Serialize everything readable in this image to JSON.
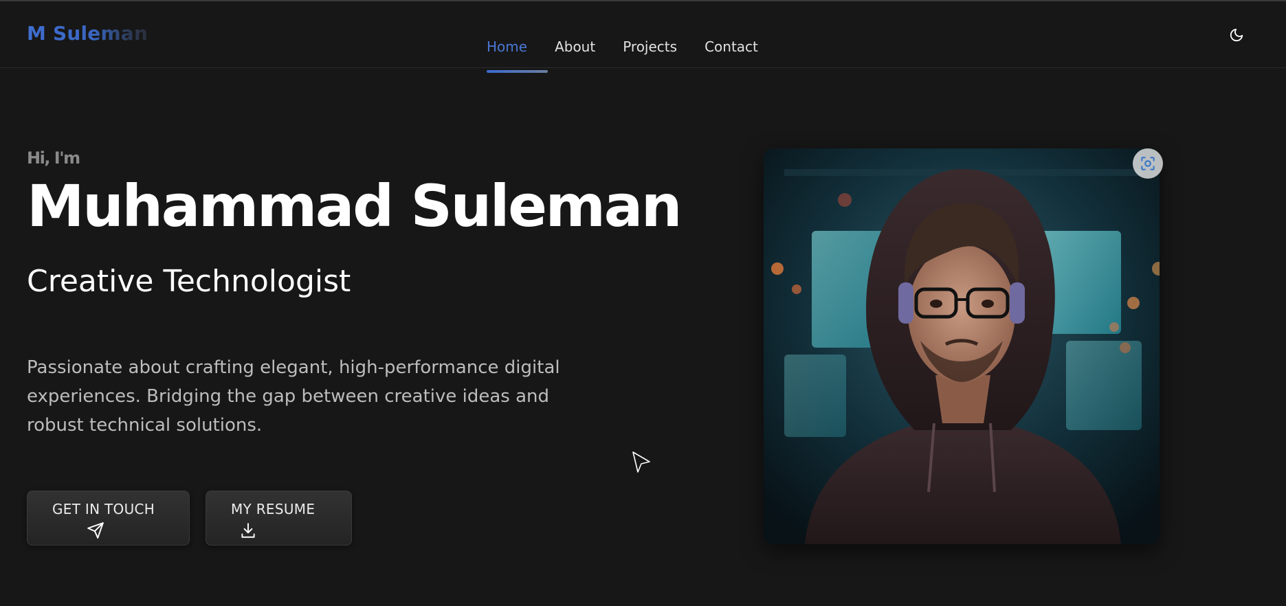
{
  "header": {
    "logo_text": "M Suleman",
    "nav": [
      {
        "label": "Home",
        "active": true
      },
      {
        "label": "About",
        "active": false
      },
      {
        "label": "Projects",
        "active": false
      },
      {
        "label": "Contact",
        "active": false
      }
    ],
    "theme_icon": "moon-icon"
  },
  "hero": {
    "greeting": "Hi, I'm",
    "name": "Muhammad Suleman",
    "role": "Creative Technologist",
    "description": "Passionate about crafting elegant, high-performance digital experiences. Bridging the gap between creative ideas and robust technical solutions.",
    "buttons": {
      "get_in_touch": {
        "label": "GET IN TOUCH",
        "icon": "send-icon"
      },
      "resume": {
        "label": "MY RESUME",
        "icon": "download-icon"
      }
    }
  },
  "portrait": {
    "alt": "portrait-photo",
    "overlay_icon": "scan-face-icon"
  },
  "colors": {
    "background": "#171717",
    "accent": "#4a78d6",
    "text_primary": "#ffffff",
    "text_secondary": "#bdbdbd"
  }
}
